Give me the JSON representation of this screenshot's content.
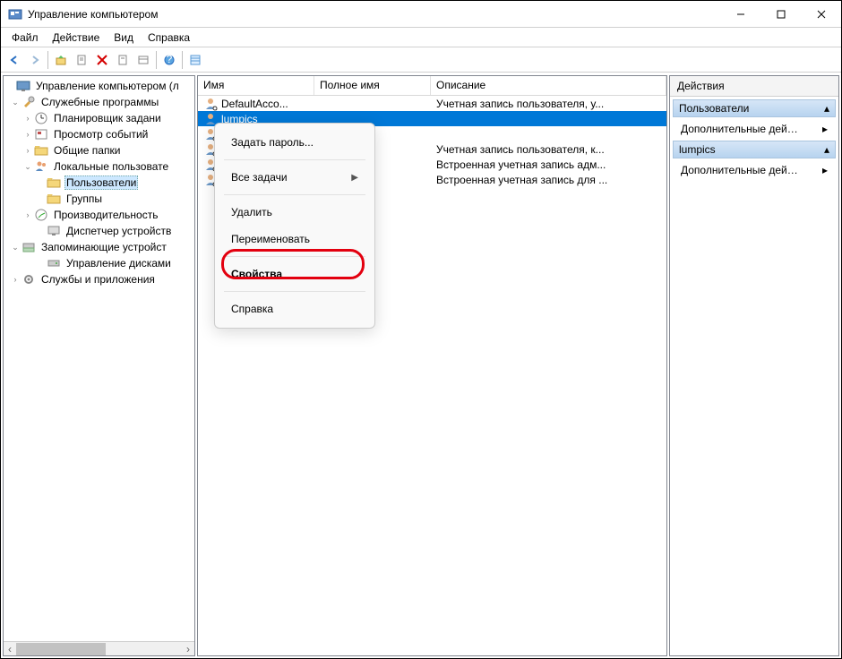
{
  "title": "Управление компьютером",
  "menu": {
    "file": "Файл",
    "action": "Действие",
    "view": "Вид",
    "help": "Справка"
  },
  "columns": {
    "name": "Имя",
    "fullname": "Полное имя",
    "desc": "Описание"
  },
  "users": [
    {
      "name": "DefaultAcco...",
      "desc": "Учетная запись пользователя, у..."
    },
    {
      "name": "lumpics",
      "desc": ""
    },
    {
      "name": "",
      "desc": ""
    },
    {
      "name": "",
      "desc": "Учетная запись пользователя, к..."
    },
    {
      "name": "",
      "desc": "Встроенная учетная запись адм..."
    },
    {
      "name": "",
      "desc": "Встроенная учетная запись для ..."
    }
  ],
  "tree": {
    "root": "Управление компьютером (л",
    "utils": "Служебные программы",
    "sched": "Планировщик задани",
    "events": "Просмотр событий",
    "shared": "Общие папки",
    "local": "Локальные пользовате",
    "users_node": "Пользователи",
    "groups": "Группы",
    "perf": "Производительность",
    "devmgr": "Диспетчер устройств",
    "storage": "Запоминающие устройст",
    "diskmgmt": "Управление дисками",
    "services": "Службы и приложения"
  },
  "ctx": {
    "set_pw": "Задать пароль...",
    "all_tasks": "Все задачи",
    "delete": "Удалить",
    "rename": "Переименовать",
    "props": "Свойства",
    "help": "Справка"
  },
  "actions": {
    "header": "Действия",
    "sec1": "Пользователи",
    "item1": "Дополнительные дей…",
    "sec2": "lumpics",
    "item2": "Дополнительные дей…"
  }
}
